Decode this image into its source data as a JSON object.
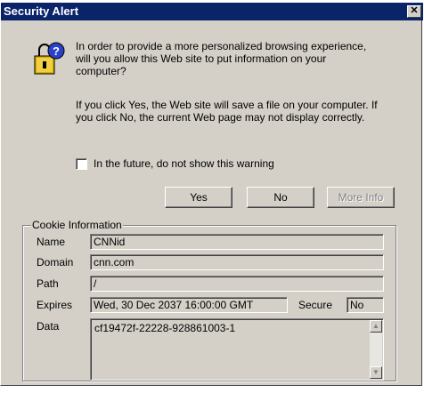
{
  "dialog": {
    "title": "Security Alert",
    "close_label": "✕",
    "message_1": "In order to provide a more personalized browsing experience, will you allow this Web site to put information on your computer?",
    "message_2": "If you click Yes, the Web site will save a file on your computer. If you click No, the current Web page may not display correctly.",
    "checkbox_label": "In the future, do not show this warning",
    "checkbox_checked": false,
    "buttons": {
      "yes": "Yes",
      "no": "No",
      "more_info": "More Info"
    }
  },
  "cookie": {
    "group_title": "Cookie Information",
    "labels": {
      "name": "Name",
      "domain": "Domain",
      "path": "Path",
      "expires": "Expires",
      "secure": "Secure",
      "data": "Data"
    },
    "values": {
      "name": "CNNid",
      "domain": "cnn.com",
      "path": "/",
      "expires": "Wed, 30 Dec 2037 16:00:00 GMT",
      "secure": "No",
      "data": "cf19472f-22228-928861003-1"
    }
  },
  "icons": {
    "lock": "lock-question-icon",
    "close": "close-icon",
    "scroll_up": "scroll-up-icon",
    "scroll_down": "scroll-down-icon"
  },
  "colors": {
    "titlebar": "#0a246a",
    "face": "#d4d0c8"
  }
}
